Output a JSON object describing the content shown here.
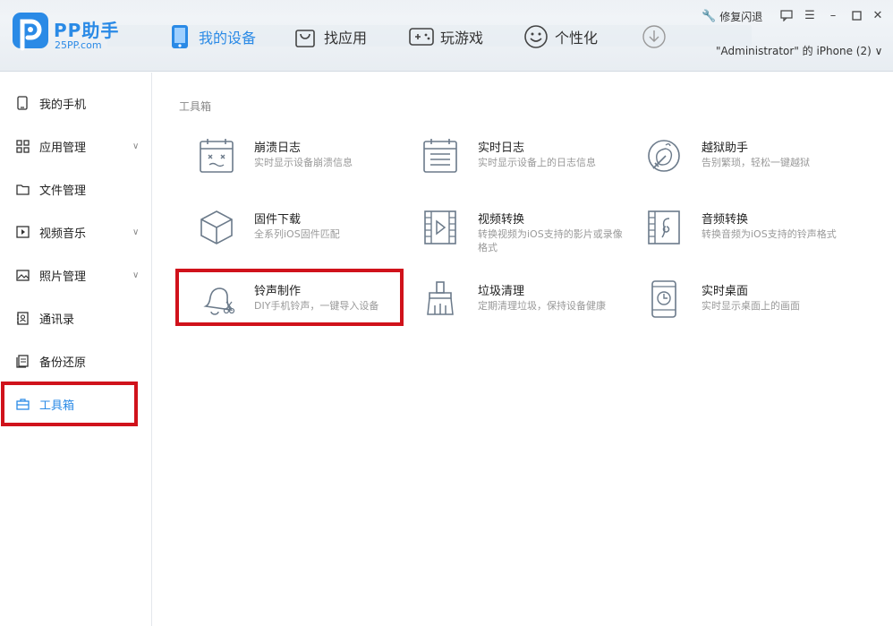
{
  "header": {
    "brand_name": "PP助手",
    "brand_url": "25PP.com",
    "nav": [
      {
        "label": "我的设备",
        "icon": "phone-icon",
        "active": true
      },
      {
        "label": "找应用",
        "icon": "shopping-bag-icon"
      },
      {
        "label": "玩游戏",
        "icon": "gamepad-icon"
      },
      {
        "label": "个性化",
        "icon": "smiley-icon"
      },
      {
        "label": "",
        "icon": "download-icon"
      }
    ],
    "repair_label": "修复闪退",
    "window_controls": [
      "feedback-icon",
      "menu-icon",
      "minimize-icon",
      "maximize-icon",
      "close-icon"
    ],
    "device_label": "\"Administrator\" 的 iPhone (2) ∨"
  },
  "sidebar": {
    "items": [
      {
        "label": "我的手机",
        "icon": "phone-outline-icon",
        "chevron": false
      },
      {
        "label": "应用管理",
        "icon": "grid-icon",
        "chevron": true
      },
      {
        "label": "文件管理",
        "icon": "folder-icon",
        "chevron": false
      },
      {
        "label": "视频音乐",
        "icon": "video-icon",
        "chevron": true
      },
      {
        "label": "照片管理",
        "icon": "photo-icon",
        "chevron": true
      },
      {
        "label": "通讯录",
        "icon": "contacts-icon",
        "chevron": false
      },
      {
        "label": "备份还原",
        "icon": "backup-icon",
        "chevron": false
      },
      {
        "label": "工具箱",
        "icon": "toolbox-icon",
        "chevron": false,
        "active": true
      }
    ]
  },
  "main": {
    "section_title": "工具箱",
    "tools": [
      {
        "name": "崩溃日志",
        "desc": "实时显示设备崩溃信息",
        "icon": "crash-log-icon"
      },
      {
        "name": "实时日志",
        "desc": "实时显示设备上的日志信息",
        "icon": "realtime-log-icon"
      },
      {
        "name": "越狱助手",
        "desc": "告别繁琐，轻松一键越狱",
        "icon": "jailbreak-icon"
      },
      {
        "name": "固件下载",
        "desc": "全系列iOS固件匹配",
        "icon": "firmware-cube-icon"
      },
      {
        "name": "视频转换",
        "desc": "转换视频为iOS支持的影片或录像格式",
        "icon": "video-convert-icon"
      },
      {
        "name": "音频转换",
        "desc": "转换音频为iOS支持的铃声格式",
        "icon": "audio-convert-icon"
      },
      {
        "name": "铃声制作",
        "desc": "DIY手机铃声，一键导入设备",
        "icon": "ringtone-bell-icon"
      },
      {
        "name": "垃圾清理",
        "desc": "定期清理垃圾，保持设备健康",
        "icon": "broom-icon"
      },
      {
        "name": "实时桌面",
        "desc": "实时显示桌面上的画面",
        "icon": "realtime-desktop-icon"
      }
    ]
  },
  "colors": {
    "accent": "#2a8ae6",
    "highlight_border": "#d0121b",
    "icon_stroke": "#6b7a8a"
  }
}
